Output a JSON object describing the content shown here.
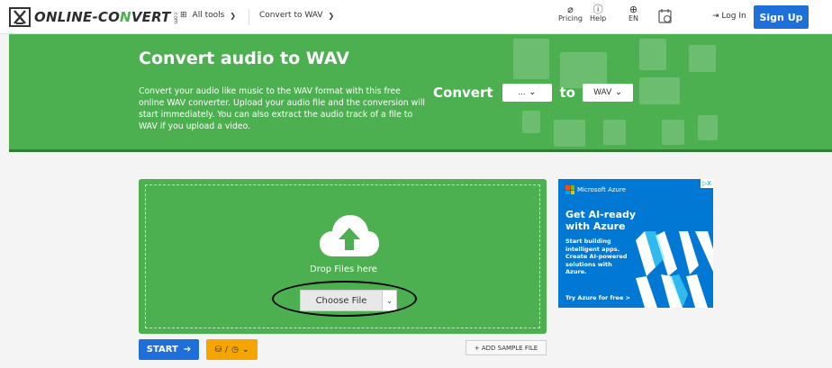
{
  "nav": {
    "logo_text_part1": "ONLINE-",
    "logo_text_part2": "CO",
    "logo_text_part3": "N",
    "logo_text_part4": "VERT",
    "logo_com": ".com",
    "alltools_label": "All tools",
    "convert_label": "Convert to WAV",
    "pricing_label": "Pricing",
    "help_label": "Help",
    "lang_label": "EN",
    "login_label": "Log In",
    "signup_label": "Sign Up",
    "accent_color": "#1e6fd9"
  },
  "hero": {
    "title": "Convert audio to WAV",
    "description": "Convert your audio like music to the WAV format with this free online WAV converter. Upload your audio file and the conversion will start immediately. You can also extract the audio track of a file to WAV if you upload a video.",
    "convert_label": "Convert",
    "from_value": "...",
    "to_label": "to",
    "to_value": "WAV",
    "bg_color": "#4caf50"
  },
  "upload": {
    "drop_text": "Drop Files here",
    "choose_label": "Choose File",
    "start_label": "START",
    "add_sample_label": "+ ADD SAMPLE FILE",
    "options_label": "/"
  },
  "ad": {
    "brand": "Microsoft Azure",
    "title": "Get AI-ready with Azure",
    "body": "Start building intelligent apps. Create AI-powered solutions with Azure.",
    "cta": "Try Azure for free >",
    "adchoice": "▷X"
  }
}
